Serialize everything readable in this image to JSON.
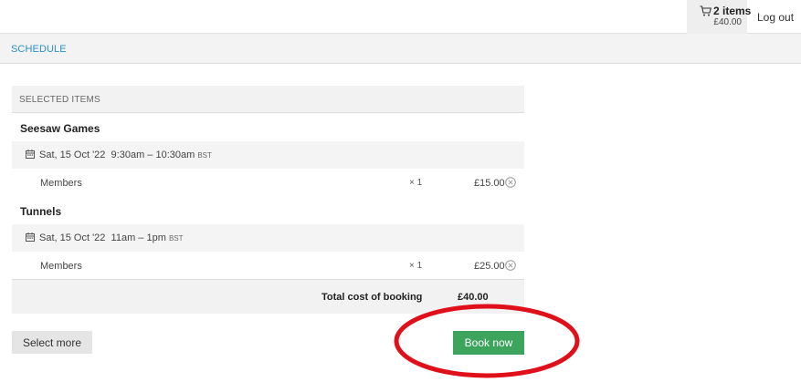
{
  "header": {
    "cart": {
      "count_label": "2 items",
      "total": "£40.00",
      "icon": "cart-icon"
    },
    "logout_label": "Log out"
  },
  "nav": {
    "schedule_label": "SCHEDULE"
  },
  "selected_items": {
    "heading": "SELECTED ITEMS",
    "events": [
      {
        "title": "Seesaw Games",
        "date": "Sat, 15 Oct '22",
        "time": "9:30am – 10:30am",
        "tz": "BST",
        "line": {
          "label": "Members",
          "qty": "× 1",
          "price": "£15.00"
        }
      },
      {
        "title": "Tunnels",
        "date": "Sat, 15 Oct '22",
        "time": "11am – 1pm",
        "tz": "BST",
        "line": {
          "label": "Members",
          "qty": "× 1",
          "price": "£25.00"
        }
      }
    ],
    "total_label": "Total cost of booking",
    "total_value": "£40.00"
  },
  "actions": {
    "select_more": "Select more",
    "book_now": "Book now"
  },
  "colors": {
    "accent_blue": "#2c8fc7",
    "book_green": "#3ca45c",
    "annotation_red": "#e0101a"
  }
}
